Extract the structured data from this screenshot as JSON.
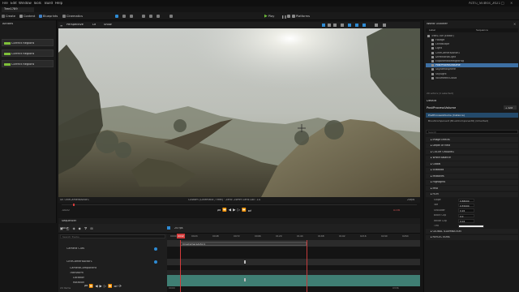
{
  "menu": [
    "File",
    "Edit",
    "Window",
    "Tools",
    "Build",
    "Help"
  ],
  "window_title": "Actru_SkiBlos_2021",
  "main_tab": "Tree1789",
  "toolbar": {
    "create": "Create",
    "content": "Content",
    "blueprints": "Blueprints",
    "cinematics": "Cinematics",
    "play": "Play",
    "platforms": "Platforms"
  },
  "left_panel": {
    "header": "Actions",
    "buttons": [
      "Correct Regions",
      "Correct Regions",
      "Correct Regions"
    ]
  },
  "viewport": {
    "mode": "Perspective",
    "view": "Lit",
    "show": "Show",
    "info_left": "UE OneCameraActor1",
    "info_center": "Custom (Cinematic / Feet) · Zero: 24mm Lens Loc: 1.0",
    "info_right": "24fps",
    "time_left": "-0000",
    "time_right": "0336"
  },
  "sequencer": {
    "tab": "Sequencer",
    "tracks_label": "TRACK",
    "search_placeholder": "Search Tracks",
    "fps": "24 fps",
    "current_frame": "0042",
    "tracks": [
      "Camera Cuts",
      "CineCameraActor1",
      "CameraComponent",
      "Transform",
      "Location",
      "Rotation"
    ],
    "ruler": [
      "0000",
      "0024",
      "0048",
      "0072",
      "0096",
      "0120",
      "0144",
      "0168",
      "0192",
      "0216",
      "0240",
      "0264"
    ],
    "section_label": "CineCameraActor1",
    "start": "0000",
    "end": "0336",
    "items_label": "24 items"
  },
  "outliner": {
    "title": "World Outliner",
    "col_label": "Label",
    "col_type": "Sequence",
    "items": [
      "Tree1789 (Editor)",
      "Foliage",
      "Landscape",
      "Light",
      "CineCameraActor1",
      "DirectionalLight",
      "ExponentialHeightFog",
      "PostProcessVolume",
      "SkyAtmosphere",
      "SkyLight",
      "VolumetricCloud"
    ],
    "selected_index": 7,
    "footer": "20 actors (1 selected)"
  },
  "details": {
    "title": "Details",
    "object": "PostProcessVolume",
    "add_label": "+ Add",
    "instance": "PostProcessVolume (Instance)",
    "component": "BrushComponent (BrushComponent0) (Inherited)",
    "search_placeholder": "Search",
    "sections": [
      "Image Effects",
      "Depth of Field",
      "COLOR GRADING",
      "White Balance",
      "Global",
      "Shadows",
      "Midtones",
      "Highlights",
      "Misc",
      "FILM",
      "GLOBAL ILLUMINATION",
      "REFLECTIONS"
    ],
    "film": [
      {
        "label": "Slope",
        "value": "0.88000"
      },
      {
        "label": "Toe",
        "value": "0.55000"
      },
      {
        "label": "Shoulder",
        "value": "0.26"
      },
      {
        "label": "Black Clip",
        "value": "0.0"
      },
      {
        "label": "White Clip",
        "value": "0.04"
      },
      {
        "label": "Tint",
        "value": ""
      }
    ]
  },
  "colors": {
    "accent": "#2e8bd4",
    "play": "#6dbb3a",
    "playhead": "#d23b3b",
    "selection": "#3d6fa3"
  }
}
